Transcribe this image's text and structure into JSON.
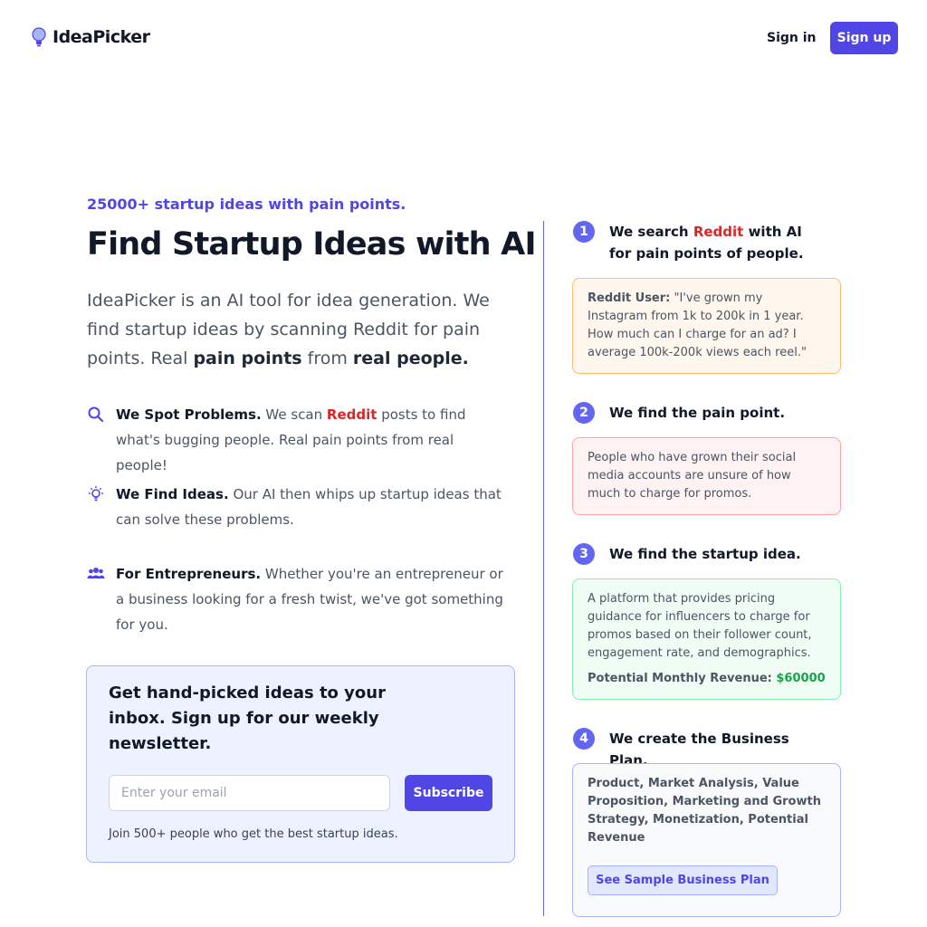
{
  "header": {
    "logo_text": "IdeaPicker",
    "signin_label": "Sign in",
    "signup_label": "Sign up"
  },
  "hero": {
    "eyebrow": "25000+ startup ideas with pain points.",
    "title": "Find Startup Ideas with AI",
    "desc_prefix": "IdeaPicker is an AI tool for idea generation. We find startup ideas by scanning Reddit for pain points. Real ",
    "desc_bold1": "pain points",
    "desc_mid": " from ",
    "desc_bold2": "real people."
  },
  "features": [
    {
      "icon": "search-icon",
      "title": "We Spot Problems.",
      "text_before": " We scan ",
      "highlight": "Reddit",
      "text_after": " posts to find what's bugging people. Real pain points from real people!"
    },
    {
      "icon": "lightbulb-icon",
      "title": "We Find Ideas.",
      "text": " Our AI then whips up startup ideas that can solve these problems."
    },
    {
      "icon": "users-icon",
      "title": "For Entrepreneurs.",
      "text": " Whether you're an entrepreneur or a business looking for a fresh twist, we've got something for you."
    }
  ],
  "newsletter": {
    "title": "Get hand-picked ideas to your inbox. Sign up for our weekly newsletter.",
    "email_placeholder": "Enter your email",
    "email_value": "",
    "button_label": "Subscribe",
    "note": "Join 500+ people who get the best startup ideas."
  },
  "steps": [
    {
      "number": "1",
      "title_before": "We search ",
      "title_highlight": "Reddit",
      "title_after": " with AI for pain points of people.",
      "card_label": "Reddit User:",
      "card_text": " \"I've grown my Instagram from 1k to 200k in 1 year. How much can I charge for an ad? I average 100k-200k views each reel.\""
    },
    {
      "number": "2",
      "title": "We find the pain point.",
      "card_text": "People who have grown their social media accounts are unsure of how much to charge for promos."
    },
    {
      "number": "3",
      "title": "We find the startup idea.",
      "card_text": "A platform that provides pricing guidance for influencers to charge for promos based on their follower count, engagement rate, and demographics.",
      "revenue_label": "Potential Monthly Revenue: ",
      "revenue_value": "$60000"
    },
    {
      "number": "4",
      "title": "We create the Business Plan.",
      "card_text": "Product, Market Analysis, Value Proposition, Marketing and Growth Strategy, Monetization, Potential Revenue",
      "button_label": "See Sample Business Plan"
    }
  ],
  "colors": {
    "accent": "#4f46e5",
    "reddit_red": "#dc2626",
    "revenue_green": "#16a34a"
  }
}
